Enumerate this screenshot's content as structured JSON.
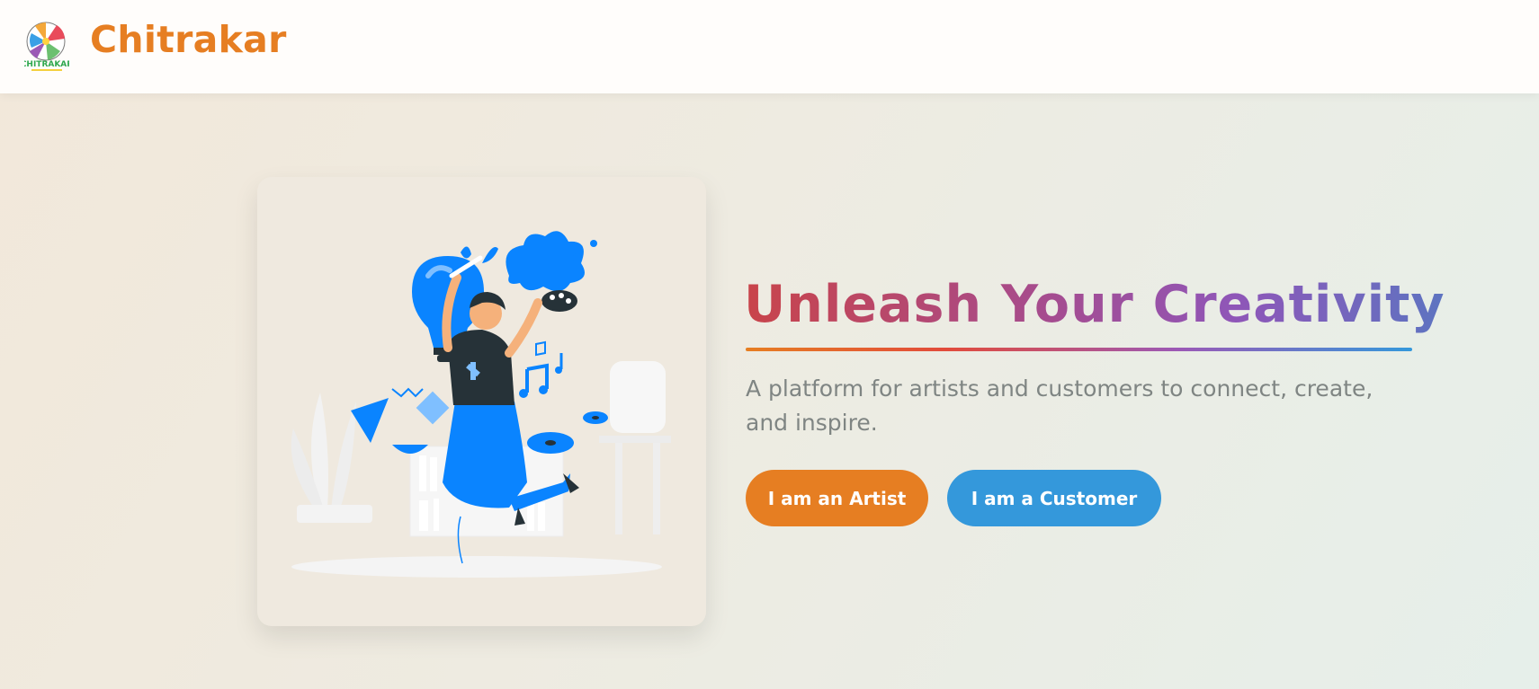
{
  "header": {
    "brand": "Chitrakar",
    "logo_text": "CHITRAKAR"
  },
  "hero": {
    "title": "Unleash Your Creativity",
    "subtitle": "A platform for artists and customers to connect, create, and inspire.",
    "artist_button": "I am an Artist",
    "customer_button": "I am a Customer"
  },
  "colors": {
    "brand_orange": "#e67e22",
    "accent_blue": "#3498db",
    "illustration_blue": "#0a84ff"
  },
  "icons": {
    "logo": "chitrakar-logo-icon",
    "illustration": "creative-person-illustration"
  }
}
